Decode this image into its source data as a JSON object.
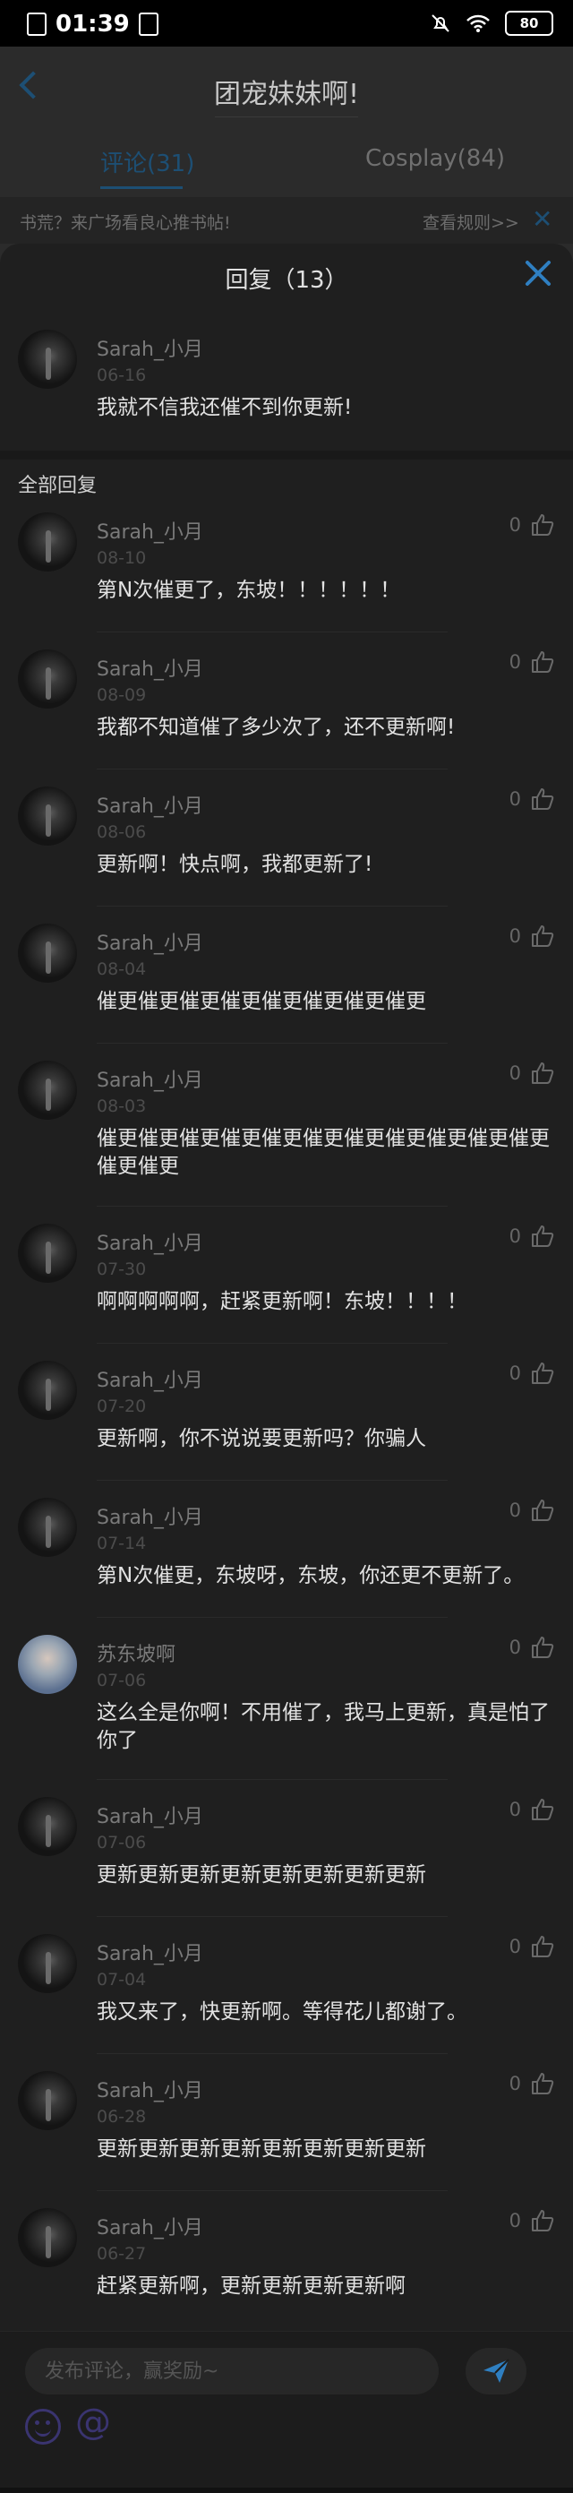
{
  "status_bar": {
    "time": "01:39",
    "battery": "80"
  },
  "page": {
    "title": "团宠妹妹啊!",
    "tabs": [
      {
        "label": "评论(31)",
        "active": true
      },
      {
        "label": "Cosplay(84)",
        "active": false
      }
    ],
    "notice": {
      "text": "书荒？来广场看良心推书帖!",
      "link": "查看规则>>"
    }
  },
  "sheet": {
    "title": "回复（13）",
    "main_comment": {
      "name": "Sarah_小月",
      "date": "06-16",
      "text": "我就不信我还催不到你更新!"
    },
    "section_title": "全部回复",
    "replies": [
      {
        "name": "Sarah_小月",
        "date": "08-10",
        "text": "第N次催更了，东坡！！！！！！",
        "likes": "0"
      },
      {
        "name": "Sarah_小月",
        "date": "08-09",
        "text": "我都不知道催了多少次了，还不更新啊!",
        "likes": "0"
      },
      {
        "name": "Sarah_小月",
        "date": "08-06",
        "text": "更新啊！快点啊，我都更新了!",
        "likes": "0"
      },
      {
        "name": "Sarah_小月",
        "date": "08-04",
        "text": "催更催更催更催更催更催更催更催更",
        "likes": "0"
      },
      {
        "name": "Sarah_小月",
        "date": "08-03",
        "text": "催更催更催更催更催更催更催更催更催更催更催更催更催更",
        "likes": "0"
      },
      {
        "name": "Sarah_小月",
        "date": "07-30",
        "text": "啊啊啊啊啊，赶紧更新啊！东坡！！！！",
        "likes": "0"
      },
      {
        "name": "Sarah_小月",
        "date": "07-20",
        "text": "更新啊，你不说说要更新吗？你骗人",
        "likes": "0"
      },
      {
        "name": "Sarah_小月",
        "date": "07-14",
        "text": "第N次催更，东坡呀，东坡，你还更不更新了。",
        "likes": "0"
      },
      {
        "name": "苏东坡啊",
        "date": "07-06",
        "text": "这么全是你啊！不用催了，我马上更新，真是怕了你了",
        "likes": "0"
      },
      {
        "name": "Sarah_小月",
        "date": "07-06",
        "text": "更新更新更新更新更新更新更新更新",
        "likes": "0"
      },
      {
        "name": "Sarah_小月",
        "date": "07-04",
        "text": "我又来了，快更新啊。等得花儿都谢了。",
        "likes": "0"
      },
      {
        "name": "Sarah_小月",
        "date": "06-28",
        "text": "更新更新更新更新更新更新更新更新",
        "likes": "0"
      },
      {
        "name": "Sarah_小月",
        "date": "06-27",
        "text": "赶紧更新啊，更新更新更新更新啊",
        "likes": "0"
      }
    ]
  },
  "composer": {
    "placeholder": "发布评论，赢奖励~"
  },
  "colors": {
    "accent": "#2f7fc1",
    "overlay_bg": "#161616",
    "sheet_bg": "#1f1f1f"
  }
}
